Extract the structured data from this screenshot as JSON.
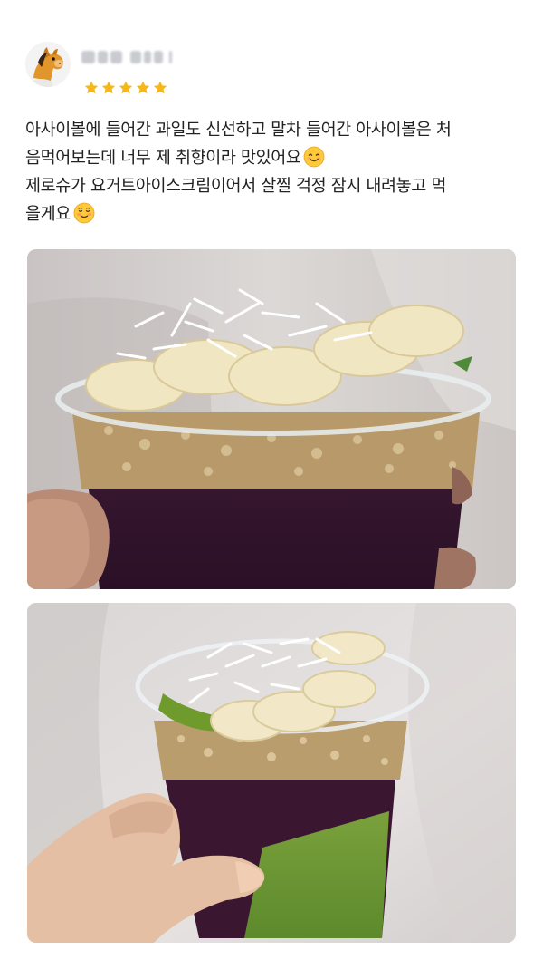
{
  "review": {
    "author": {
      "name": "",
      "avatar_icon": "horse-avatar-icon"
    },
    "rating": {
      "value": 5,
      "max": 5,
      "star_color": "#f6b818"
    },
    "text_lines": [
      "아사이볼에 들어간 과일도 신선하고 말차 들어간 아사이볼은 처",
      "음먹어보는데 너무 제 취향이라 맛있어요",
      "제로슈가 요거트아이스크림이어서 살찔 걱정 잠시 내려놓고 먹",
      "을게요"
    ],
    "emojis": [
      "smiling-face-emoji",
      "relieved-smile-emoji"
    ],
    "photos": [
      {
        "subject": "acai-bowl-photo-1",
        "icon": "photo-icon"
      },
      {
        "subject": "acai-bowl-photo-2",
        "icon": "photo-icon"
      }
    ]
  }
}
